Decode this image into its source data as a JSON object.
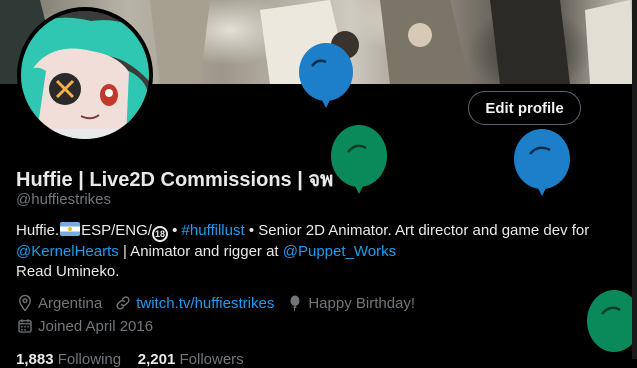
{
  "profile": {
    "display_name": "Huffie | Live2D Commissions | จพ",
    "handle": "@huffiestrikes",
    "bio": {
      "part1": "Huffie.",
      "part2": "ESP/ENG/",
      "part3": " • ",
      "hashtag": "#huffillust",
      "part4": " • Senior 2D Animator. Art director and game dev for ",
      "mention1": "@KernelHearts",
      "part5": " | Animator and rigger at ",
      "mention2": "@Puppet_Works",
      "line3": "Read Umineko.",
      "age_badge": "18"
    },
    "location": "Argentina",
    "website": "twitch.tv/huffiestrikes",
    "birthday": "Happy Birthday!",
    "joined": "Joined April 2016",
    "following_count": "1,883",
    "following_label": "Following",
    "followers_count": "2,201",
    "followers_label": "Followers"
  },
  "buttons": {
    "edit_profile": "Edit profile"
  },
  "icons": {
    "location": "location-pin-icon",
    "link": "link-icon",
    "birthday": "balloon-icon",
    "calendar": "calendar-icon"
  },
  "colors": {
    "accent": "#1d9bf0",
    "muted": "#71767b",
    "balloon_blue": "#1d7fc9",
    "balloon_green": "#0a8a5a"
  }
}
